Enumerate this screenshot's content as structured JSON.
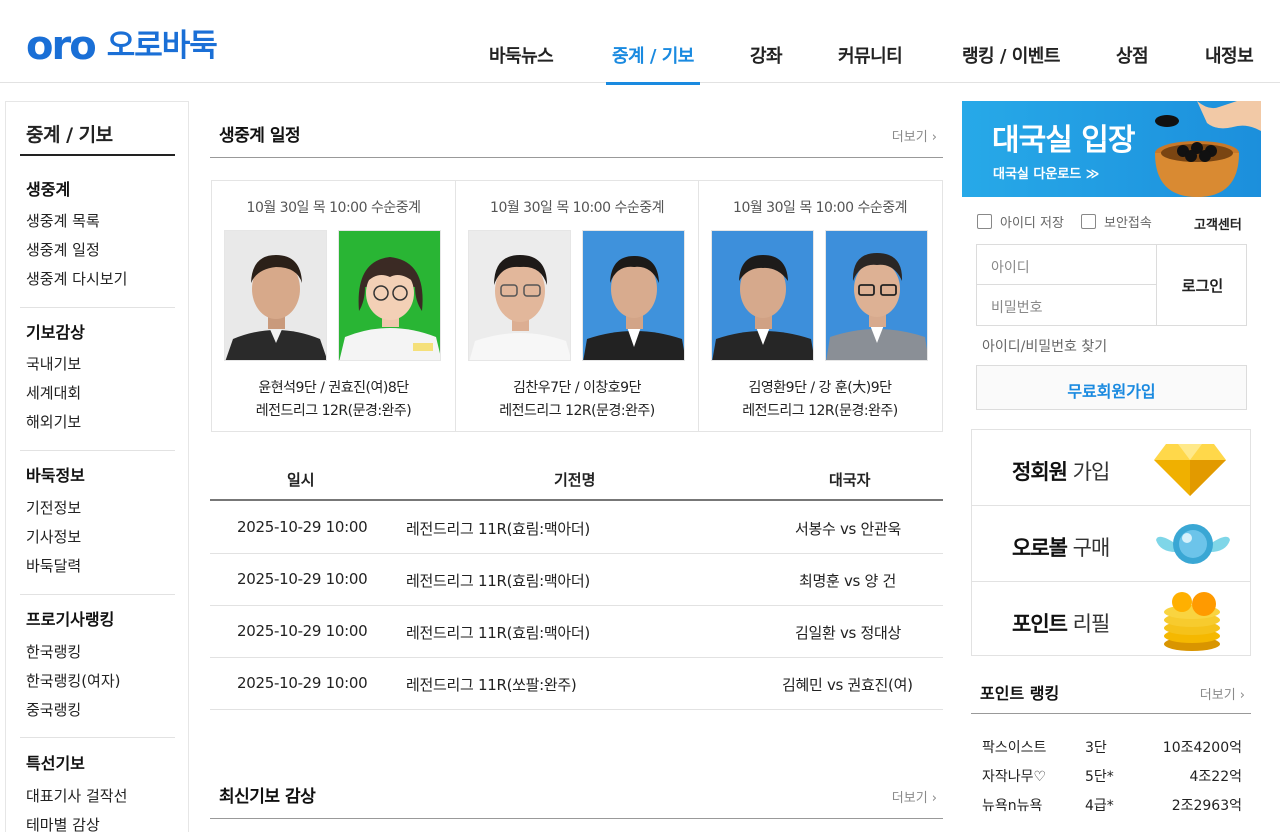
{
  "header": {
    "logo_text": "oro",
    "logo_ko": "오로바둑",
    "nav": [
      "바둑뉴스",
      "중계 / 기보",
      "강좌",
      "커뮤니티",
      "랭킹 / 이벤트",
      "상점",
      "내정보"
    ]
  },
  "sidebar": {
    "title": "중계 / 기보",
    "groups": [
      {
        "title": "생중계",
        "items": [
          "생중계 목록",
          "생중계 일정",
          "생중계 다시보기"
        ]
      },
      {
        "title": "기보감상",
        "items": [
          "국내기보",
          "세계대회",
          "해외기보"
        ]
      },
      {
        "title": "바둑정보",
        "items": [
          "기전정보",
          "기사정보",
          "바둑달력"
        ]
      },
      {
        "title": "프로기사랭킹",
        "items": [
          "한국랭킹",
          "한국랭킹(여자)",
          "중국랭킹"
        ]
      },
      {
        "title": "특선기보",
        "items": [
          "대표기사 걸작선",
          "테마별 감상"
        ]
      }
    ]
  },
  "live": {
    "title": "생중계 일정",
    "more": "더보기 ›",
    "cards": [
      {
        "date": "10월 30일 목 10:00  수순중계",
        "names": "윤현석9단 / 권효진(여)8단",
        "league": "레전드리그 12R(문경:완주)"
      },
      {
        "date": "10월 30일 목 10:00  수순중계",
        "names": "김찬우7단 / 이창호9단",
        "league": "레전드리그 12R(문경:완주)"
      },
      {
        "date": "10월 30일 목 10:00  수순중계",
        "names": "김영환9단 / 강 훈(大)9단",
        "league": "레전드리그 12R(문경:완주)"
      }
    ],
    "table": {
      "headers": [
        "일시",
        "기전명",
        "대국자"
      ],
      "rows": [
        {
          "date": "2025-10-29  10:00",
          "event": "레전드리그 11R(효림:맥아더)",
          "players": "서봉수 vs 안관욱"
        },
        {
          "date": "2025-10-29  10:00",
          "event": "레전드리그 11R(효림:맥아더)",
          "players": "최명훈 vs 양 건"
        },
        {
          "date": "2025-10-29  10:00",
          "event": "레전드리그 11R(효림:맥아더)",
          "players": "김일환 vs 정대상"
        },
        {
          "date": "2025-10-29  10:00",
          "event": "레전드리그 11R(쏘팔:완주)",
          "players": "김혜민 vs 권효진(여)"
        }
      ]
    }
  },
  "recent": {
    "title": "최신기보 감상",
    "more": "더보기 ›"
  },
  "right": {
    "enter_title": "대국실 입장",
    "enter_sub": "대국실 다운로드 ≫",
    "save_id": "아이디 저장",
    "secure": "보안접속",
    "support": "고객센터",
    "id_placeholder": "아이디",
    "pw_placeholder": "비밀번호",
    "login": "로그인",
    "find": "아이디/비밀번호 찾기",
    "join": "무료회원가입",
    "promos": [
      {
        "bold": "정회원",
        "rest": " 가입",
        "icon": "diamond-icon"
      },
      {
        "bold": "오로볼",
        "rest": " 구매",
        "icon": "winged-ball-icon"
      },
      {
        "bold": "포인트",
        "rest": " 리필",
        "icon": "coins-icon"
      }
    ],
    "rank_title": "포인트 랭킹",
    "rank_more": "더보기 ›",
    "ranking": [
      {
        "name": "팍스이스트",
        "grade": "3단",
        "points": "10조4200억"
      },
      {
        "name": "자작나무♡",
        "grade": "5단*",
        "points": "4조22억"
      },
      {
        "name": "뉴욕n뉴욕",
        "grade": "4급*",
        "points": "2조2963억"
      }
    ]
  }
}
